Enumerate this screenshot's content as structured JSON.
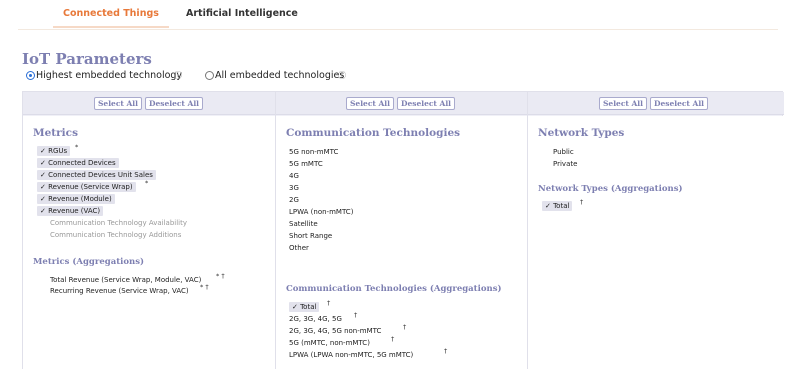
{
  "tabs": [
    {
      "label": "Connected Things",
      "active": true
    },
    {
      "label": "Artificial Intelligence",
      "active": false
    }
  ],
  "page_title": "IoT Parameters",
  "radio_options": [
    {
      "label": "Highest embedded technology",
      "checked": true
    },
    {
      "label": "All embedded technologies",
      "checked": false
    }
  ],
  "select_all_label": "Select All",
  "deselect_all_label": "Deselect All",
  "info_glyph": "ⓘ",
  "columns": {
    "metrics": {
      "title": "Metrics",
      "items": [
        {
          "label": "✓ RGUs",
          "mark": "*"
        },
        {
          "label": "✓ Connected Devices",
          "mark": ""
        },
        {
          "label": "✓ Connected Devices Unit Sales",
          "mark": ""
        },
        {
          "label": "✓ Revenue (Service Wrap)",
          "mark": "*"
        },
        {
          "label": "✓ Revenue (Module)",
          "mark": ""
        },
        {
          "label": "✓ Revenue (VAC)",
          "mark": ""
        },
        {
          "label": "Communication Technology Availability",
          "mark": ""
        },
        {
          "label": "Communication Technology Additions",
          "mark": ""
        }
      ],
      "agg_title": "Metrics (Aggregations)",
      "agg_items": [
        {
          "label": "Total Revenue (Service Wrap, Module, VAC)",
          "mark": "* †"
        },
        {
          "label": "Recurring Revenue (Service Wrap, VAC)",
          "mark": "* †"
        }
      ]
    },
    "comm": {
      "title": "Communication Technologies",
      "items": [
        "5G non-mMTC",
        "5G mMTC",
        "4G",
        "3G",
        "2G",
        "LPWA (non-mMTC)",
        "Satellite",
        "Short Range",
        "Other"
      ],
      "agg_title": "Communication Technologies (Aggregations)",
      "agg_items": [
        {
          "label": "✓ Total",
          "mark": "†"
        },
        {
          "label": "2G, 3G, 4G, 5G",
          "mark": "†"
        },
        {
          "label": "2G, 3G, 4G, 5G non-mMTC",
          "mark": "†"
        },
        {
          "label": "5G (mMTC, non-mMTC)",
          "mark": "†"
        },
        {
          "label": "LPWA (LPWA non-mMTC, 5G mMTC)",
          "mark": "†"
        }
      ]
    },
    "network": {
      "title": "Network Types",
      "items": [
        "Public",
        "Private"
      ],
      "agg_title": "Network Types (Aggregations)",
      "agg_items": [
        {
          "label": "✓ Total",
          "mark": "†"
        }
      ]
    }
  },
  "colors": {
    "accent": "#e8793a",
    "section_title": "#7d7fb1",
    "selected_bg": "#e2e2ec"
  },
  "icons": {
    "info": "info-icon",
    "check": "check-icon",
    "radio": "radio-icon"
  }
}
